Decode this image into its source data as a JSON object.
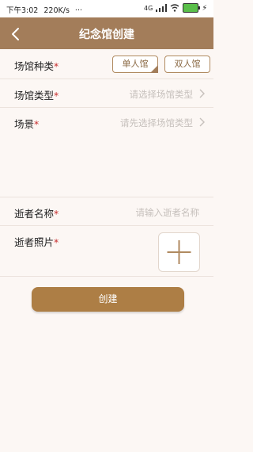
{
  "status_bar": {
    "time": "下午3:02",
    "speed": "220K/s",
    "signal": "4G",
    "battery": "100"
  },
  "header": {
    "title": "纪念馆创建",
    "back_icon": "chevron-left-icon",
    "background": "#a37d5a"
  },
  "form": {
    "venue_category": {
      "label": "场馆种类",
      "required_mark": "*",
      "options": [
        "单人馆",
        "双人馆"
      ],
      "selected": "单人馆"
    },
    "venue_type": {
      "label": "场馆类型",
      "required_mark": "*",
      "placeholder": "请选择场馆类型"
    },
    "scene": {
      "label": "场景",
      "required_mark": "*",
      "placeholder": "请先选择场馆类型"
    },
    "deceased_name": {
      "label": "逝者名称",
      "required_mark": "*",
      "placeholder": "请输入逝者名称"
    },
    "deceased_photo": {
      "label": "逝者照片",
      "required_mark": "*",
      "add_icon": "plus-icon"
    }
  },
  "actions": {
    "create_label": "创建",
    "accent": "#ad7e45"
  }
}
